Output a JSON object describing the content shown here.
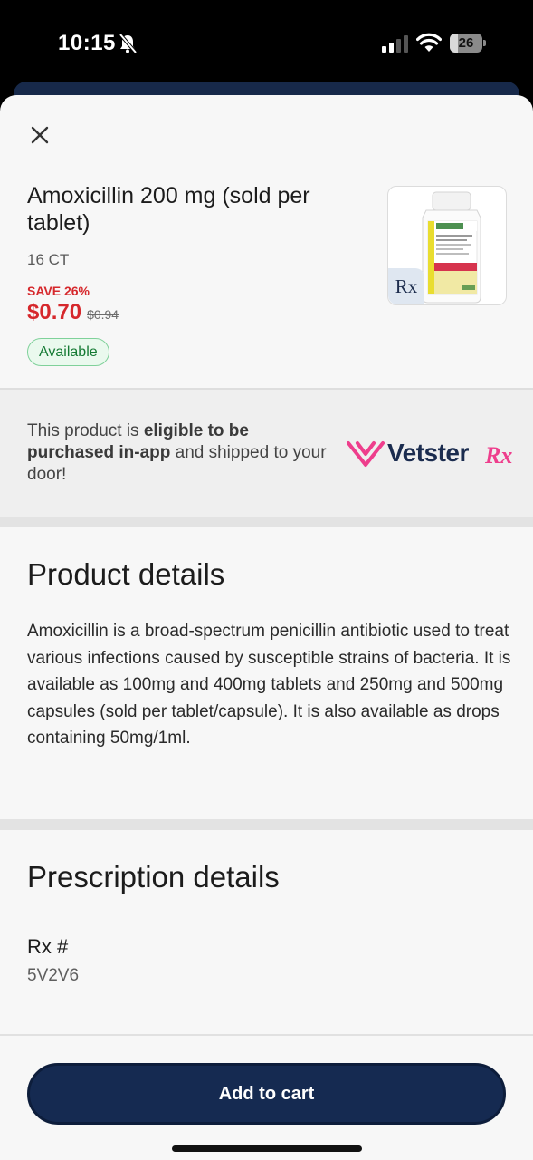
{
  "status_bar": {
    "time": "10:15",
    "battery_level": "26",
    "battery_fraction": 0.26
  },
  "product": {
    "title": "Amoxicillin 200 mg (sold per tablet)",
    "count": "16 CT",
    "save_label": "SAVE 26%",
    "price_now": "$0.70",
    "price_was": "$0.94",
    "availability": "Available",
    "rx_badge": "Rx"
  },
  "promo": {
    "text_1": "This product is ",
    "text_bold": "eligible to be purchased in-app",
    "text_2": " and shipped to your door!",
    "brand_name": "Vetster",
    "brand_rx": "Rx"
  },
  "product_details": {
    "title": "Product details",
    "body": "Amoxicillin is a broad-spectrum penicillin antibiotic used to treat various infections caused by susceptible strains of bacteria. It is available as 100mg and 400mg tablets and 250mg and 500mg capsules (sold per tablet/capsule).  It is also available as drops containing 50mg/1ml."
  },
  "prescription_details": {
    "title": "Prescription details",
    "rx_label": "Rx #",
    "rx_value": "5V2V6"
  },
  "actions": {
    "add_to_cart": "Add to cart"
  },
  "colors": {
    "primary": "#152a51",
    "sale": "#d6282c",
    "available": "#157a34",
    "brand_pink": "#ee3e8c"
  }
}
